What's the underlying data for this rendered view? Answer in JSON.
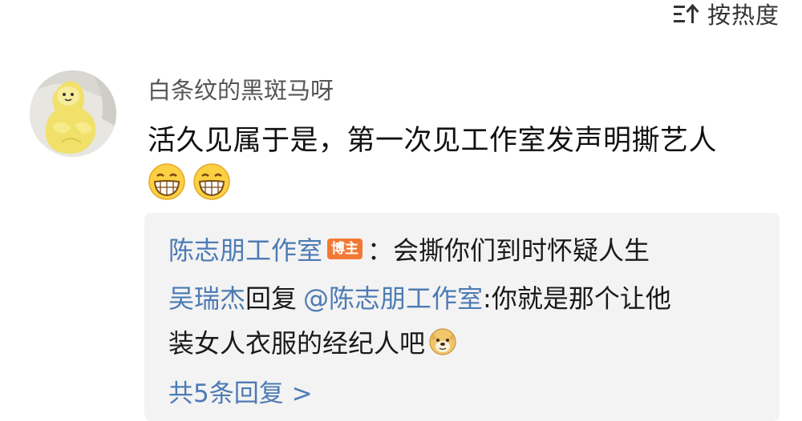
{
  "sort": {
    "label": "按热度",
    "icon": "sort-icon"
  },
  "comment": {
    "avatar_icon": "avatar-banana-plush",
    "username": "白条纹的黑斑马呀",
    "text": "活久见属于是，第一次见工作室发声明撕艺人",
    "emojis": [
      "grin-emoji",
      "grin-emoji"
    ]
  },
  "replies": {
    "reply1": {
      "author": "陈志朋工作室",
      "badge": "博主",
      "separator": "：",
      "text": "会撕你们到时怀疑人生"
    },
    "reply2": {
      "author": "吴瑞杰",
      "action": "回复",
      "mention": "@陈志朋工作室",
      "text_line1": ":你就是那个让他",
      "text_line2": "装女人衣服的经纪人吧",
      "emoji": "doge-emoji"
    },
    "more_label": "共5条回复 >"
  },
  "colors": {
    "link": "#4d7bb4",
    "badge": "#f27935",
    "reply_bg": "#f3f3f3",
    "text": "#111111",
    "username": "#555555"
  }
}
